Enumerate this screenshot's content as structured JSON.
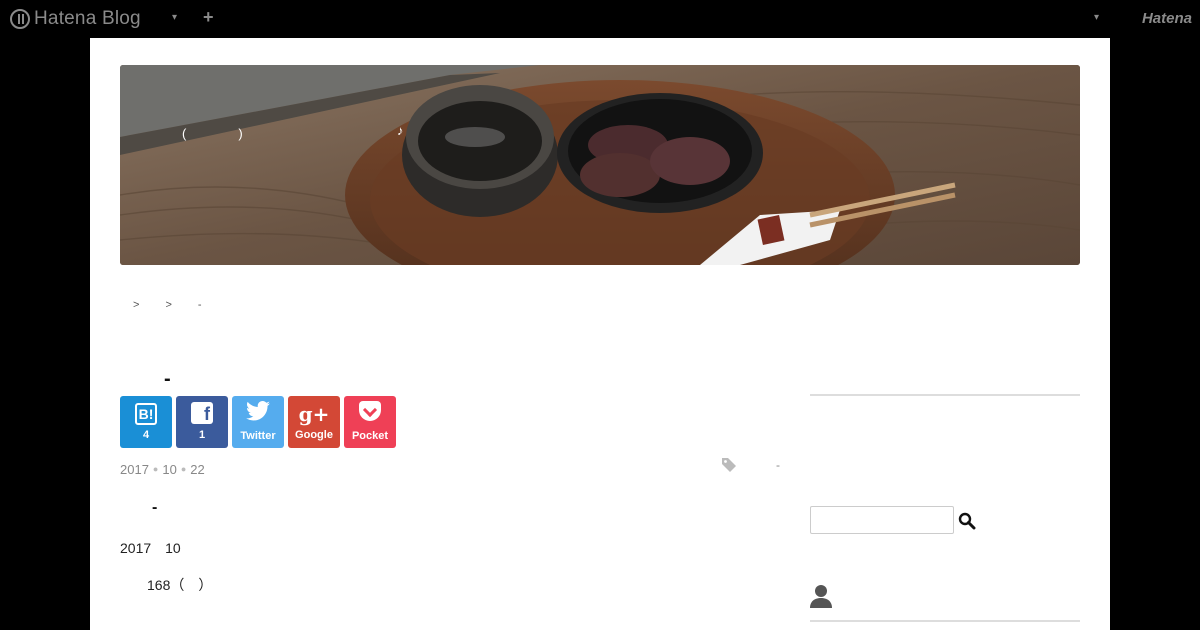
{
  "topbar": {
    "logo_text": "Hatena Blog",
    "right_logo_text": "Hatena",
    "plus": "+",
    "dropdown_glyph": "▾"
  },
  "header": {
    "title_fragment": "(　　　　)",
    "note": "♪"
  },
  "breadcrumb": {
    "sep1": ">",
    "sep2": ">",
    "last": "-"
  },
  "entry": {
    "title": "-",
    "date_year": "2017",
    "date_month": "10",
    "date_day": "22",
    "tag_text": "-",
    "heading": "-",
    "p1": "2017　10",
    "p2": "168（　）"
  },
  "share": {
    "hatena_label": "B!",
    "hatena_count": "4",
    "facebook_label": "f",
    "facebook_count": "1",
    "twitter_label": "Twitter",
    "google_icon": "g+",
    "google_label": "Google",
    "pocket_label": "Pocket"
  },
  "colors": {
    "hatena": "#1a8fd6",
    "facebook": "#3b5b9c",
    "twitter": "#55acee",
    "google": "#d34836",
    "pocket": "#ef4056"
  },
  "icons": [
    "hatena-logo-icon",
    "dropdown-icon",
    "plus-icon",
    "tag-icon",
    "search-icon",
    "profile-icon",
    "bird-icon",
    "pocket-icon"
  ]
}
